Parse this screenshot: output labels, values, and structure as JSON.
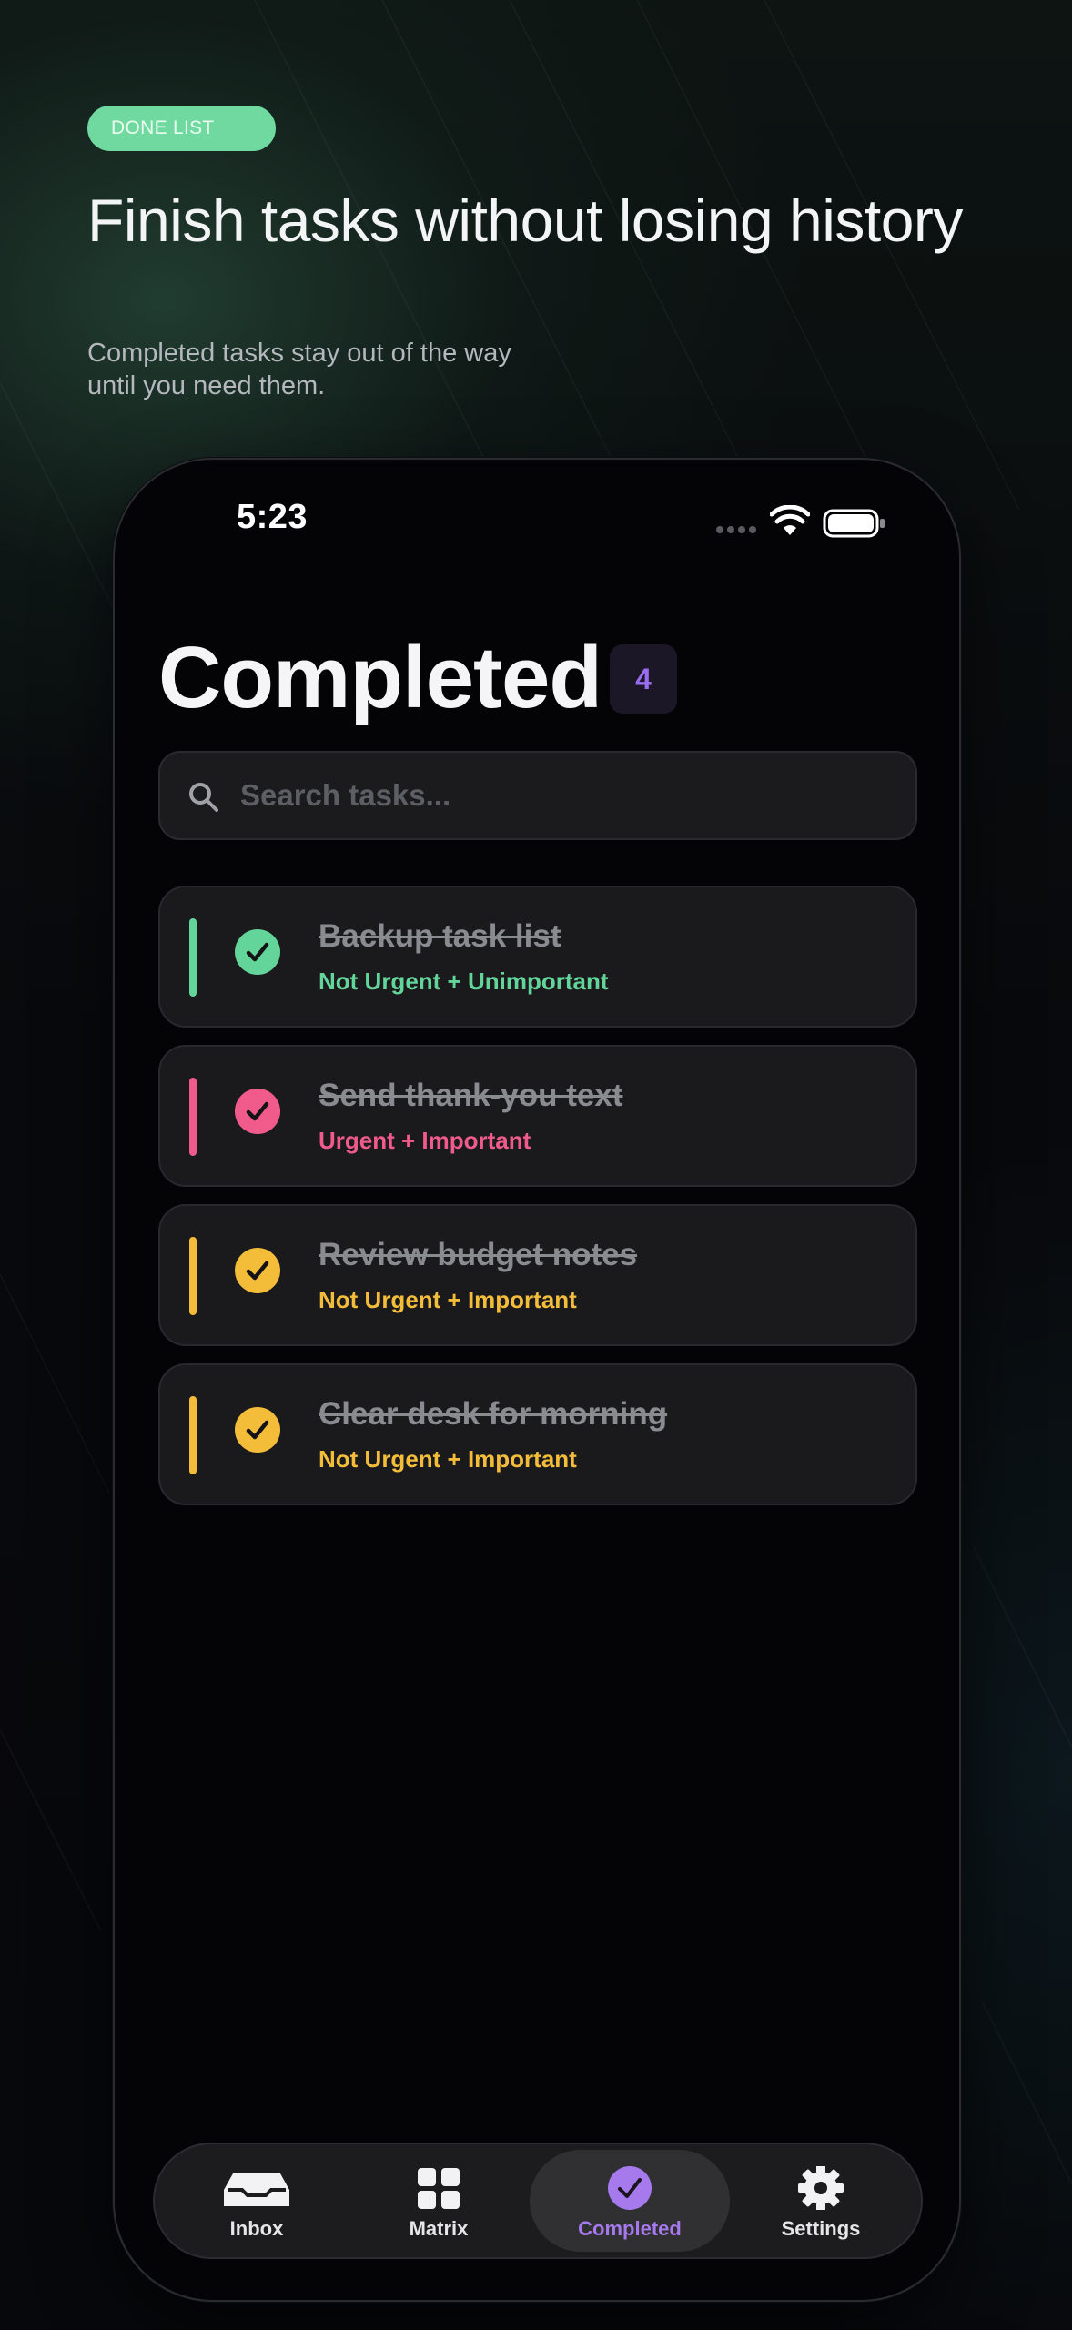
{
  "hero": {
    "tag": "DONE LIST",
    "headline": "Finish tasks without losing history",
    "subtext_line1": "Completed tasks stay out of the way",
    "subtext_line2": "until you need them."
  },
  "status_bar": {
    "time": "5:23"
  },
  "screen": {
    "title": "Completed",
    "count": "4"
  },
  "search": {
    "placeholder": "Search tasks..."
  },
  "colors": {
    "green": "#63d59a",
    "pink": "#f05b8b",
    "yellow": "#f4bd39",
    "purple": "#a679ec"
  },
  "tasks": [
    {
      "title": "Backup task list",
      "quadrant": "Not Urgent + Unimportant",
      "color": "#63d59a"
    },
    {
      "title": "Send thank-you text",
      "quadrant": "Urgent + Important",
      "color": "#f05b8b"
    },
    {
      "title": "Review budget notes",
      "quadrant": "Not Urgent + Important",
      "color": "#f4bd39"
    },
    {
      "title": "Clear desk for morning",
      "quadrant": "Not Urgent + Important",
      "color": "#f4bd39"
    }
  ],
  "tabs": [
    {
      "label": "Inbox",
      "icon": "inbox-icon",
      "active": false
    },
    {
      "label": "Matrix",
      "icon": "grid-icon",
      "active": false
    },
    {
      "label": "Completed",
      "icon": "check-circle-icon",
      "active": true
    },
    {
      "label": "Settings",
      "icon": "gear-icon",
      "active": false
    }
  ]
}
